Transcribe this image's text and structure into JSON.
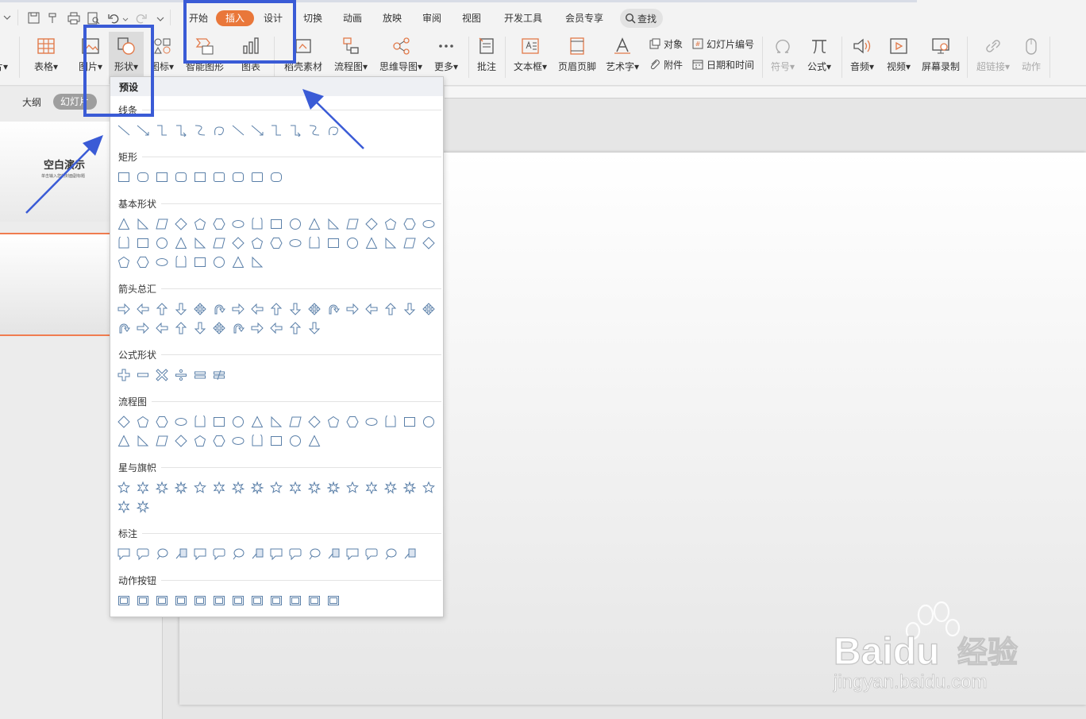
{
  "titlebar": {
    "tabs": [
      {
        "label": "开始",
        "active": false
      },
      {
        "label": "插入",
        "active": true
      },
      {
        "label": "设计",
        "active": false
      },
      {
        "label": "切换",
        "active": false
      },
      {
        "label": "动画",
        "active": false
      },
      {
        "label": "放映",
        "active": false
      },
      {
        "label": "审阅",
        "active": false
      },
      {
        "label": "视图",
        "active": false
      },
      {
        "label": "开发工具",
        "active": false
      },
      {
        "label": "会员专享",
        "active": false
      }
    ],
    "search_label": "查找"
  },
  "ribbon": {
    "items": [
      {
        "label": "片",
        "icon": "slide-icon"
      },
      {
        "label": "表格",
        "icon": "table-icon"
      },
      {
        "label": "图片",
        "icon": "picture-icon"
      },
      {
        "label": "形状",
        "icon": "shape-icon"
      },
      {
        "label": "图标",
        "icon": "icon-library-icon"
      },
      {
        "label": "智能图形",
        "icon": "smartart-icon"
      },
      {
        "label": "图表",
        "icon": "chart-icon"
      },
      {
        "label": "稻壳素材",
        "icon": "material-icon"
      },
      {
        "label": "流程图",
        "icon": "flowchart-icon"
      },
      {
        "label": "思维导图",
        "icon": "mindmap-icon"
      },
      {
        "label": "更多",
        "icon": "more-icon"
      },
      {
        "label": "批注",
        "icon": "comment-icon"
      },
      {
        "label": "文本框",
        "icon": "textbox-icon"
      },
      {
        "label": "页眉页脚",
        "icon": "header-footer-icon"
      },
      {
        "label": "艺术字",
        "icon": "wordart-icon"
      },
      {
        "label": "符号",
        "icon": "symbol-icon"
      },
      {
        "label": "公式",
        "icon": "formula-icon"
      },
      {
        "label": "音频",
        "icon": "audio-icon"
      },
      {
        "label": "视频",
        "icon": "video-icon"
      },
      {
        "label": "屏幕录制",
        "icon": "screen-record-icon"
      },
      {
        "label": "超链接",
        "icon": "hyperlink-icon"
      },
      {
        "label": "动作",
        "icon": "action-icon"
      }
    ],
    "small": {
      "object": "对象",
      "attachment": "附件",
      "slide_number": "幻灯片编号",
      "datetime": "日期和时间"
    }
  },
  "panel": {
    "tab_outline": "大纲",
    "tab_slides": "幻灯片",
    "slide1_title": "空白演示",
    "slide1_subtitle": "单击输入您的封面副标题"
  },
  "shapes_menu": {
    "header": "预设",
    "categories": [
      {
        "name": "线条",
        "count": 12
      },
      {
        "name": "矩形",
        "count": 9
      },
      {
        "name": "基本形状",
        "count": 42
      },
      {
        "name": "箭头总汇",
        "count": 28
      },
      {
        "name": "公式形状",
        "count": 6
      },
      {
        "name": "流程图",
        "count": 28
      },
      {
        "name": "星与旗帜",
        "count": 19
      },
      {
        "name": "标注",
        "count": 16
      },
      {
        "name": "动作按钮",
        "count": 12
      }
    ]
  },
  "watermark": {
    "brand": "Baidu",
    "product": "经验",
    "url": "jingyan.baidu.com"
  },
  "colors": {
    "accent": "#e9773a",
    "annotation": "#3a5bd6",
    "shape_stroke": "#5a7fa8"
  }
}
